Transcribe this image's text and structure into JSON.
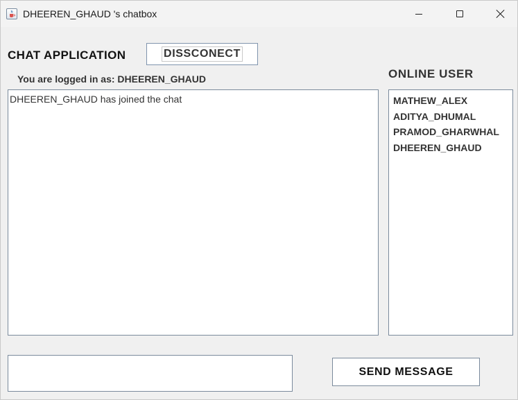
{
  "window": {
    "title": "DHEEREN_GHAUD 's chatbox",
    "icon": "java-cup-icon"
  },
  "header": {
    "heading": "CHAT APPLICATION",
    "disconnect_label": "DISSCONECT",
    "logged_in_label": "You are logged in as: DHEEREN_GHAUD"
  },
  "chat": {
    "messages": [
      "DHEEREN_GHAUD has joined the chat"
    ]
  },
  "online": {
    "heading": "ONLINE USER",
    "users": [
      "MATHEW_ALEX",
      "ADITYA_DHUMAL",
      "PRAMOD_GHARWHAL",
      "DHEEREN_GHAUD"
    ]
  },
  "composer": {
    "message_value": "",
    "send_label": "SEND MESSAGE"
  },
  "colors": {
    "window_background": "#f0f0f0",
    "field_border": "#7a8a9c",
    "button_border": "#7f93ad"
  }
}
